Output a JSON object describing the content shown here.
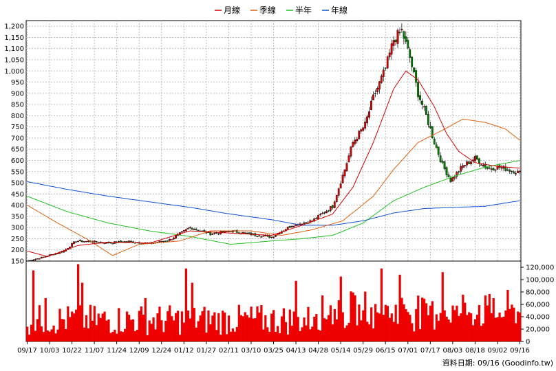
{
  "chart_data": {
    "type": "candlestick",
    "legend": [
      {
        "name": "月線",
        "color": "#d40000"
      },
      {
        "name": "季線",
        "color": "#e06010"
      },
      {
        "name": "半年",
        "color": "#22c022"
      },
      {
        "name": "年線",
        "color": "#1050d0"
      }
    ],
    "legend_position": "top-center",
    "price_axis": {
      "ticks": [
        "1,200",
        "1,150",
        "1,100",
        "1,050",
        "1,000",
        "950",
        "900",
        "850",
        "800",
        "750",
        "700",
        "650",
        "600",
        "550",
        "500",
        "450",
        "400",
        "350",
        "300",
        "250",
        "200",
        "150"
      ],
      "ylim": [
        150,
        1225
      ],
      "grid": true
    },
    "volume_axis": {
      "ticks": [
        "120,000",
        "100,000",
        "80,000",
        "60,000",
        "40,000",
        "20,000",
        "0"
      ],
      "ylim": [
        0,
        130000
      ],
      "position": "right"
    },
    "x_ticks": [
      "09/17",
      "10/03",
      "10/22",
      "11/07",
      "11/24",
      "12/09",
      "12/24",
      "01/12",
      "01/27",
      "02/11",
      "03/10",
      "03/25",
      "04/13",
      "04/28",
      "05/14",
      "05/29",
      "06/15",
      "07/01",
      "07/17",
      "08/03",
      "08/18",
      "09/02",
      "09/16"
    ],
    "source_note": "資料日期: 09/16  (Goodinfo.tw)",
    "close_keypoints": [
      [
        0,
        150
      ],
      [
        8,
        168
      ],
      [
        18,
        195
      ],
      [
        24,
        240
      ],
      [
        30,
        238
      ],
      [
        40,
        232
      ],
      [
        50,
        238
      ],
      [
        60,
        228
      ],
      [
        70,
        245
      ],
      [
        80,
        300
      ],
      [
        90,
        272
      ],
      [
        100,
        285
      ],
      [
        110,
        270
      ],
      [
        120,
        258
      ],
      [
        130,
        310
      ],
      [
        140,
        330
      ],
      [
        150,
        395
      ],
      [
        156,
        560
      ],
      [
        160,
        680
      ],
      [
        166,
        760
      ],
      [
        170,
        880
      ],
      [
        176,
        1010
      ],
      [
        180,
        1140
      ],
      [
        184,
        1180
      ],
      [
        188,
        1060
      ],
      [
        192,
        900
      ],
      [
        196,
        800
      ],
      [
        200,
        680
      ],
      [
        204,
        580
      ],
      [
        208,
        510
      ],
      [
        214,
        575
      ],
      [
        220,
        610
      ],
      [
        226,
        565
      ],
      [
        232,
        570
      ],
      [
        238,
        555
      ],
      [
        242,
        545
      ]
    ],
    "ma_month_keypoints": [
      [
        0,
        195
      ],
      [
        10,
        170
      ],
      [
        25,
        220
      ],
      [
        40,
        235
      ],
      [
        60,
        230
      ],
      [
        80,
        285
      ],
      [
        100,
        275
      ],
      [
        120,
        265
      ],
      [
        135,
        310
      ],
      [
        150,
        360
      ],
      [
        160,
        480
      ],
      [
        170,
        680
      ],
      [
        180,
        920
      ],
      [
        186,
        1000
      ],
      [
        192,
        960
      ],
      [
        200,
        840
      ],
      [
        206,
        720
      ],
      [
        212,
        640
      ],
      [
        220,
        590
      ],
      [
        230,
        575
      ],
      [
        242,
        565
      ]
    ],
    "ma_quarter_keypoints": [
      [
        0,
        400
      ],
      [
        15,
        320
      ],
      [
        30,
        245
      ],
      [
        42,
        175
      ],
      [
        55,
        225
      ],
      [
        75,
        240
      ],
      [
        90,
        285
      ],
      [
        110,
        285
      ],
      [
        125,
        265
      ],
      [
        140,
        290
      ],
      [
        155,
        330
      ],
      [
        170,
        440
      ],
      [
        180,
        560
      ],
      [
        192,
        680
      ],
      [
        205,
        740
      ],
      [
        214,
        785
      ],
      [
        225,
        770
      ],
      [
        235,
        740
      ],
      [
        242,
        690
      ]
    ],
    "ma_half_keypoints": [
      [
        0,
        440
      ],
      [
        20,
        370
      ],
      [
        40,
        320
      ],
      [
        60,
        285
      ],
      [
        80,
        260
      ],
      [
        100,
        225
      ],
      [
        120,
        240
      ],
      [
        135,
        250
      ],
      [
        150,
        265
      ],
      [
        165,
        320
      ],
      [
        180,
        420
      ],
      [
        195,
        480
      ],
      [
        210,
        530
      ],
      [
        225,
        570
      ],
      [
        242,
        600
      ]
    ],
    "ma_year_keypoints": [
      [
        0,
        505
      ],
      [
        20,
        470
      ],
      [
        40,
        440
      ],
      [
        60,
        415
      ],
      [
        80,
        390
      ],
      [
        100,
        360
      ],
      [
        120,
        335
      ],
      [
        135,
        310
      ],
      [
        150,
        310
      ],
      [
        165,
        330
      ],
      [
        180,
        365
      ],
      [
        195,
        385
      ],
      [
        210,
        390
      ],
      [
        225,
        395
      ],
      [
        242,
        420
      ]
    ]
  }
}
